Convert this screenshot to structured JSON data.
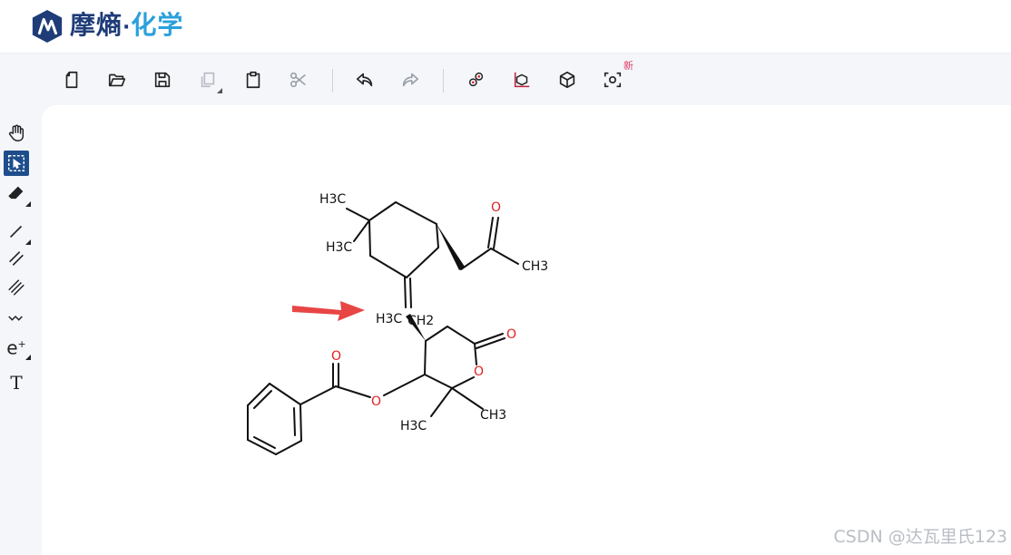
{
  "brand": {
    "name_part1": "摩熵",
    "separator": "·",
    "name_part2": "化学"
  },
  "toolbar": {
    "new_badge": "新",
    "buttons": [
      "new-file-icon",
      "open-folder-icon",
      "save-icon",
      "copy-icon",
      "paste-icon",
      "cut-icon",
      "undo-icon",
      "redo-icon",
      "3d-molecule-icon",
      "3d-chart-icon",
      "cube-icon",
      "scan-icon"
    ]
  },
  "sidebar": {
    "tools": [
      "hand-icon",
      "select-icon",
      "eraser-icon",
      "single-bond-icon",
      "double-bond-icon",
      "triple-bond-icon",
      "wavy-bond-icon",
      "charge-icon",
      "text-icon"
    ],
    "active_tool": "select-icon",
    "charge_label": "e",
    "charge_sup": "+",
    "text_label": "T"
  },
  "molecule": {
    "labels": {
      "h3c_top": "H3C",
      "h3c_mid": "H3C",
      "o_ketone": "O",
      "ch3_ketone": "CH3",
      "h3c_left": "H3C",
      "ch2": "CH2",
      "o_lactone": "O",
      "o_ring": "O",
      "o_ester_carbonyl": "O",
      "o_ester": "O",
      "h3c_bottom": "H3C",
      "ch3_bottom": "CH3"
    },
    "colors": {
      "bond": "#111111",
      "oxygen": "#e02020",
      "arrow": "#e84545"
    }
  },
  "watermark": "CSDN @达瓦里氏123"
}
